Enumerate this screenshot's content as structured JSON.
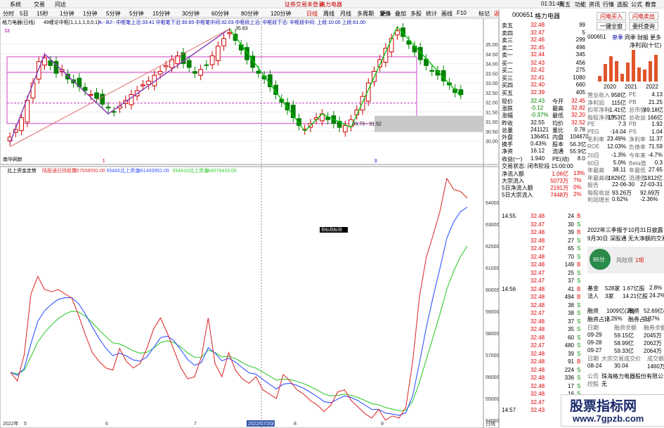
{
  "menu": {
    "items": [
      "系统",
      "交易",
      "问达"
    ],
    "center_title": "证券交易未登录",
    "center_stock": "格力电器",
    "time": "01:31:45",
    "week": "周五",
    "right": [
      "功能",
      "资讯",
      "行情",
      "选股",
      "公式",
      "教育"
    ]
  },
  "period": {
    "tabs": [
      "分时",
      "5日",
      "15秒",
      "1分钟",
      "1分钟",
      "5分钟",
      "5分钟",
      "15分钟",
      "30分钟",
      "60分钟",
      "80分钟",
      "120分钟",
      "日线",
      "周线",
      "月线",
      "多周期",
      "更多"
    ],
    "tools": [
      "复权",
      "叠加",
      "多股",
      "统计",
      "画线",
      "F10",
      "标记",
      "返回"
    ]
  },
  "chart": {
    "upper_title": "格力电器(日线)",
    "indicator": "49缠论中枢(1,1,1,1,0,0,1)",
    "indicator_vals": "A:-  BJ:-  中枢笔上沿:33.41  中枢笔下沿:30.65  中枢笔中间:32.03  中枢段上沿:  中枢段下沿:  中枢段中间:  上段:10.00  上段:61.00",
    "y_ticks": [
      "35.00",
      "34.50",
      "34.00",
      "33.50",
      "33.00",
      "32.50",
      "32.00",
      "31.50",
      "31.00",
      "30.50",
      "30.00"
    ],
    "hi_label": "35.83",
    "lo_label": "30.73 - 31.52",
    "top_left": "33",
    "bottom_label": "南华网新",
    "sig1": "1",
    "sig2": "3",
    "lower_title": "北上资金走势",
    "lower_legend": [
      {
        "name": "陆股通日持股数",
        "val": "557558592.00"
      },
      {
        "name": "EMA5北上资金",
        "val": "561493952.00"
      },
      {
        "name": "EMA10北上资金",
        "val": "564076416.00"
      }
    ],
    "lower_ticks": [
      "64000",
      "63000",
      "62000",
      "61000",
      "60000",
      "59000",
      "58000",
      "57000",
      "56000",
      "55000",
      "54000"
    ],
    "popup": "指标指标指",
    "x_labels": [
      "2022年",
      "5",
      "6",
      "7",
      "2022/07/20/三",
      "8",
      "9"
    ],
    "x_right": "日线",
    "colors": {
      "up": "#d00000",
      "down": "#008000",
      "zs_box": "#cc44cc",
      "bi_line": "#00c000",
      "duan_line": "#9933cc",
      "ema5": "#3355ff",
      "ema10": "#33cc33",
      "holding": "#dd3333"
    }
  },
  "side": {
    "code": "000651",
    "name": "格力电器",
    "buttons": [
      "闪电买入",
      "闪电卖出",
      "一键全窗",
      "委托查询"
    ],
    "sells": [
      {
        "l": "卖五",
        "p": "32.48",
        "v": "99"
      },
      {
        "l": "卖四",
        "p": "32.47",
        "v": "5"
      },
      {
        "l": "卖三",
        "p": "32.46",
        "v": "299"
      },
      {
        "l": "卖二",
        "p": "32.45",
        "v": "496"
      },
      {
        "l": "卖一",
        "p": "32.44",
        "v": "345"
      }
    ],
    "buys": [
      {
        "l": "买一",
        "p": "32.43",
        "v": "456"
      },
      {
        "l": "买二",
        "p": "32.42",
        "v": "275"
      },
      {
        "l": "买三",
        "p": "32.41",
        "v": "1080"
      },
      {
        "l": "买四",
        "p": "32.40",
        "v": "660"
      },
      {
        "l": "买五",
        "p": "32.39",
        "v": "405"
      }
    ],
    "quote": [
      [
        "现价",
        "32.43",
        "今开",
        "32.45"
      ],
      [
        "涨跌",
        "-0.12",
        "最高",
        "32.82"
      ],
      [
        "涨幅",
        "-0.37%",
        "最低",
        "32.20"
      ],
      [
        "昨收",
        "32.55",
        "均价",
        "32.52"
      ],
      [
        "总量",
        "241121",
        "量比",
        "0.78"
      ],
      [
        "外盘",
        "136451",
        "内盘",
        "104670"
      ],
      [
        "换手",
        "0.43%",
        "股本",
        "56.3亿"
      ],
      [
        "净资",
        "16.12",
        "流通",
        "55.9亿"
      ],
      [
        "收益(一)",
        "1.940",
        "PE(动)",
        "8.0"
      ]
    ],
    "trade_status": "交易状态: 闭市阶段 15:00:00",
    "flows": [
      [
        "净流入额",
        "1.06亿",
        "13%"
      ],
      [
        "大宗流入",
        "5073万",
        "7%"
      ],
      [
        "5日净流入额",
        "2191万",
        "0%"
      ],
      [
        "5日大宗流入",
        "7448万",
        "2%"
      ]
    ],
    "fin_tabs": [
      "单季",
      "同季",
      "财报",
      "更多"
    ],
    "fin_title": "净利润(十亿)",
    "fin_years": [
      "2020",
      "2021",
      "2022"
    ],
    "fin_bars": [
      1.2,
      3.6,
      5.1,
      4.1,
      1.6,
      3.9,
      6.5,
      2.9,
      2.5,
      4.2,
      5.5
    ],
    "fin": [
      [
        "营业收入",
        "958亿",
        "PE",
        "4.13"
      ],
      [
        "净利润",
        "115亿",
        "PB",
        "21.25"
      ],
      [
        "扣非净利",
        "-1.41亿",
        "总市值",
        "49.18亿"
      ],
      [
        "每股净资产",
        "1353亿",
        "总收益",
        "166亿"
      ],
      [
        "PE",
        "7.3",
        "PB",
        "1.92"
      ],
      [
        "PEG",
        "-14.04",
        "PS",
        "1.04"
      ],
      [
        "毛利率",
        "23.49%",
        "净利率",
        "11.37"
      ],
      [
        "ROE",
        "12.03%",
        "负债率",
        "71.59"
      ]
    ],
    "perf": [
      [
        "20日",
        "-1.3%",
        "今年来",
        "-4.7%"
      ],
      [
        "60日",
        "5.0%",
        "Beta值",
        "0.3"
      ],
      [
        "年最高",
        "38.11",
        "年最低",
        "27.65"
      ],
      [
        "年最高收",
        "1826亿",
        "流通值",
        "1812亿"
      ]
    ],
    "report": [
      [
        "报告",
        "22-06-30",
        "22-03-31"
      ],
      [
        "每股收益",
        "93.26万",
        "92.69万"
      ],
      [
        "利润增长",
        "0.62%",
        "-2.36%"
      ]
    ],
    "ticks": [
      [
        "14:55",
        "32.48",
        "24",
        "B"
      ],
      [
        "",
        "32.47",
        "30",
        "S"
      ],
      [
        "",
        "32.48",
        "39",
        "B"
      ],
      [
        "",
        "32.48",
        "27",
        "S"
      ],
      [
        "",
        "32.47",
        "65",
        "S"
      ],
      [
        "",
        "32.48",
        "70",
        "S"
      ],
      [
        "",
        "32.48",
        "149",
        "B"
      ],
      [
        "",
        "32.47",
        "25",
        "S"
      ],
      [
        "",
        "32.47",
        "37",
        "S"
      ],
      [
        "14:56",
        "32.48",
        "41",
        "B"
      ],
      [
        "",
        "32.48",
        "494",
        "B"
      ],
      [
        "",
        "32.48",
        "38",
        "S"
      ],
      [
        "",
        "32.47",
        "38",
        "S"
      ],
      [
        "",
        "32.48",
        "37",
        "S"
      ],
      [
        "",
        "32.48",
        "35",
        "S"
      ],
      [
        "",
        "32.48",
        "60",
        "S"
      ],
      [
        "",
        "32.47",
        "480",
        "S"
      ],
      [
        "",
        "32.48",
        "39",
        "S"
      ],
      [
        "",
        "32.48",
        "91",
        "B"
      ],
      [
        "",
        "32.48",
        "224",
        "S"
      ],
      [
        "",
        "32.48",
        "336",
        "S"
      ],
      [
        "",
        "32.48",
        "17",
        "S"
      ],
      [
        "",
        "32.48",
        "16",
        "S"
      ],
      [
        "",
        "32.47",
        "86",
        "B"
      ],
      [
        "14:57",
        "32.43",
        "0",
        "S"
      ]
    ],
    "news": "2022年三季报于10月31日披露",
    "news2": "9月30日 深股通 无大净额的交易",
    "risk_score": "95分",
    "risk_label": "风险项",
    "risk_count": "1项",
    "holders": [
      [
        "基金",
        "528家",
        "1.67亿股",
        "2.8%"
      ],
      [
        "法人",
        "3家",
        "14.21亿股",
        "24.2%"
      ]
    ],
    "margin": [
      [
        "融资",
        "1009亿(26)",
        "融资",
        "52.69亿(5)"
      ],
      [
        "融资占比",
        "3.26%",
        "融券占比",
        "0.37%"
      ]
    ],
    "margin_hdr": [
      "日期",
      "融资余额",
      "融券余额"
    ],
    "margin_rows": [
      [
        "09-29",
        "59.15亿",
        "2045万"
      ],
      [
        "09-28",
        "58.99亿",
        "2062万"
      ],
      [
        "09-27",
        "59.33亿",
        "2064万"
      ]
    ],
    "block_hdr": [
      "日期",
      "大宗交易成交价",
      "成交额"
    ],
    "block_row": [
      "08-24",
      "30.04",
      "1460万"
    ],
    "company_lbl": "公司",
    "company": "珠海格力电器股份有限公司",
    "ctrl_lbl": "控股",
    "ctrl": "无",
    "watermark1": "股票指标网",
    "watermark2": "www.7gpzb.com"
  }
}
